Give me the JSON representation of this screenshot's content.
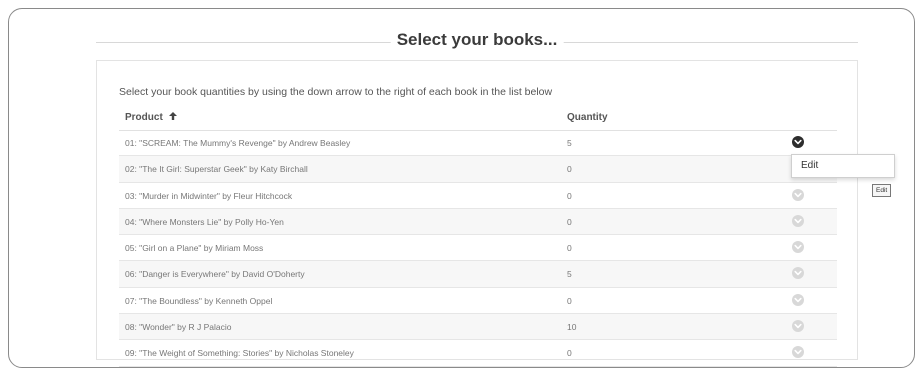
{
  "heading": "Select your books...",
  "instructions": "Select your book quantities by using the down arrow to the right of each book in the list below",
  "table": {
    "columns": {
      "product": "Product",
      "quantity": "Quantity"
    },
    "rows": [
      {
        "product": "01: \"SCREAM: The Mummy's Revenge\" by Andrew Beasley",
        "quantity": "5"
      },
      {
        "product": "02: \"The It Girl: Superstar Geek\" by Katy Birchall",
        "quantity": "0"
      },
      {
        "product": "03: \"Murder in Midwinter\" by Fleur Hitchcock",
        "quantity": "0"
      },
      {
        "product": "04: \"Where Monsters Lie\" by Polly Ho-Yen",
        "quantity": "0"
      },
      {
        "product": "05: \"Girl on a Plane\" by Miriam Moss",
        "quantity": "0"
      },
      {
        "product": "06: \"Danger is Everywhere\" by David O'Doherty",
        "quantity": "5"
      },
      {
        "product": "07: \"The Boundless\" by Kenneth Oppel",
        "quantity": "0"
      },
      {
        "product": "08: \"Wonder\" by R J Palacio",
        "quantity": "10"
      },
      {
        "product": "09: \"The Weight of Something: Stories\" by Nicholas Stoneley",
        "quantity": "0"
      }
    ]
  },
  "dropdown_menu": {
    "edit_label": "Edit"
  },
  "tooltip": "Edit",
  "icons": {
    "sort": "arrow-up-icon",
    "row_action": "chevron-down-icon"
  },
  "colors": {
    "active_button": "#2d2d2d",
    "inactive_button": "#d8d8d8"
  }
}
